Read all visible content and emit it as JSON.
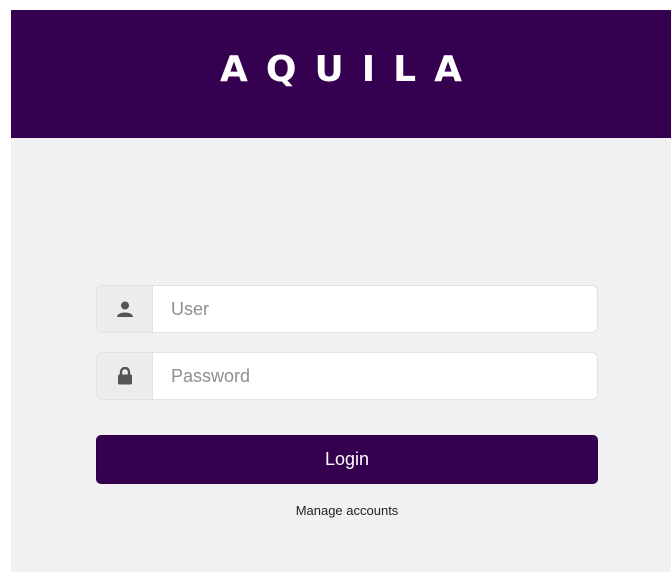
{
  "header": {
    "logo_text": "AQUILA",
    "background_color": "#360050"
  },
  "login_form": {
    "user_field": {
      "value": "",
      "placeholder": "User",
      "icon": "user-icon"
    },
    "password_field": {
      "value": "",
      "placeholder": "Password",
      "icon": "lock-icon"
    },
    "login_button_label": "Login",
    "manage_accounts_label": "Manage accounts"
  },
  "colors": {
    "accent": "#360050",
    "page_background": "#f1f1f3"
  }
}
